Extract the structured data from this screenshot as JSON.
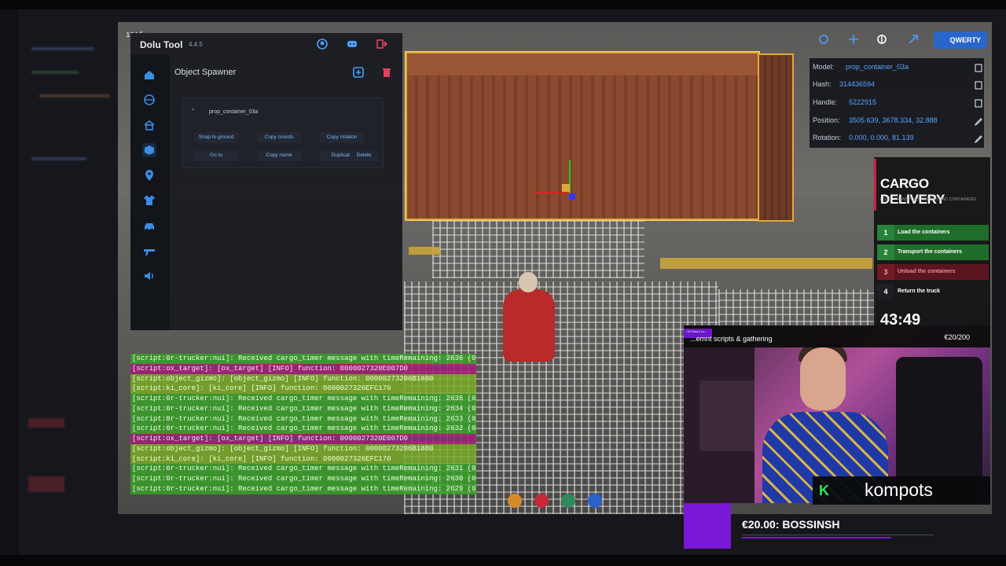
{
  "fps": "101fps",
  "dolu_tool": {
    "title": "Dolu Tool",
    "version": "4.4.5",
    "section_title": "Object Spawner",
    "object": {
      "name": "prop_container_03a",
      "buttons": {
        "snap_to_ground": "Snap to ground",
        "copy_coords": "Copy coords",
        "copy_rotation": "Copy rotation",
        "go_to": "Go to",
        "copy_name": "Copy name",
        "duplicate": "Duplicate",
        "delete": "Delete"
      }
    },
    "sidebar_icons": [
      "home-icon",
      "globe-icon",
      "house-icon",
      "cube-icon",
      "map-pin-icon",
      "shirt-icon",
      "car-icon",
      "weapon-icon",
      "speaker-icon"
    ],
    "header_icons": [
      "github-icon",
      "discord-icon",
      "logout-icon"
    ]
  },
  "console_lines": [
    {
      "kind": "g",
      "text": "[script:0r-trucker:nui]: Received cargo_timer message with timeRemaining: 2636 (0r-"
    },
    {
      "kind": "p",
      "text": "[script:ox_target]: [ox_target] [INFO] function: 0000027320E007D0"
    },
    {
      "kind": "y",
      "text": "[script:object_gizmo]: [object_gizmo] [INFO] function: 00000273206B1880"
    },
    {
      "kind": "y",
      "text": "[script:ki_core]: [ki_core] [INFO] function: 0000027326EFC170"
    },
    {
      "kind": "g",
      "text": "[script:0r-trucker:nui]: Received cargo_timer message with timeRemaining: 2635 (0r-"
    },
    {
      "kind": "g",
      "text": "[script:0r-trucker:nui]: Received cargo_timer message with timeRemaining: 2634 (0r-"
    },
    {
      "kind": "g",
      "text": "[script:0r-trucker:nui]: Received cargo_timer message with timeRemaining: 2633 (0r-"
    },
    {
      "kind": "g",
      "text": "[script:0r-trucker:nui]: Received cargo_timer message with timeRemaining: 2632 (0r-"
    },
    {
      "kind": "p",
      "text": "[script:ox_target]: [ox_target] [INFO] function: 0000027320E007D0"
    },
    {
      "kind": "y",
      "text": "[script:object_gizmo]: [object_gizmo] [INFO] function: 00000273206B1880"
    },
    {
      "kind": "y",
      "text": "[script:ki_core]: [ki_core] [INFO] function: 0000027326EFC170"
    },
    {
      "kind": "g",
      "text": "[script:0r-trucker:nui]: Received cargo_timer message with timeRemaining: 2631 (0r-"
    },
    {
      "kind": "g",
      "text": "[script:0r-trucker:nui]: Received cargo_timer message with timeRemaining: 2630 (0r-"
    },
    {
      "kind": "g",
      "text": "[script:0r-trucker:nui]: Received cargo_timer message with timeRemaining: 2629 (0r-"
    }
  ],
  "entity_info": {
    "model_label": "Model:",
    "model": "prop_container_03a",
    "hash_label": "Hash:",
    "hash": "314436594",
    "handle_label": "Handle:",
    "handle": "5222915",
    "position_label": "Position:",
    "position": "3505.639, 3678.334, 32.888",
    "rotation_label": "Rotation:",
    "rotation": "0.000, 0.000, 81.139"
  },
  "gizmo_toolbar": {
    "keyboard_layout": "QWERTY",
    "icons": [
      "snap-icon",
      "move-icon",
      "rotate-icon",
      "local-space-icon"
    ]
  },
  "cargo": {
    "title": "CARGO DELIVERY",
    "subtitle": "LOAD, TRANSPORT AND UNLOAD CONTAINERS",
    "steps": [
      {
        "num": "1",
        "label": "Load the containers",
        "state": "done"
      },
      {
        "num": "2",
        "label": "Transport the containers",
        "state": "done"
      },
      {
        "num": "3",
        "label": "Unload the containers",
        "state": "current"
      },
      {
        "num": "4",
        "label": "Return the truck",
        "state": "todo"
      }
    ],
    "timer": "43:49"
  },
  "stream": {
    "badge": "~19 Hours Lo...",
    "topic": "...emnt scripts & gathering",
    "goal": "€20/200",
    "streamer": "kompots",
    "donation": "€20.00: BOSSINSH"
  },
  "colors": {
    "accent_blue": "#59a5ff",
    "done_green": "#1e6e2a",
    "current_red": "#5a1620",
    "cargo_accent": "#d41d3a",
    "brand_purple": "#7a18d8"
  }
}
